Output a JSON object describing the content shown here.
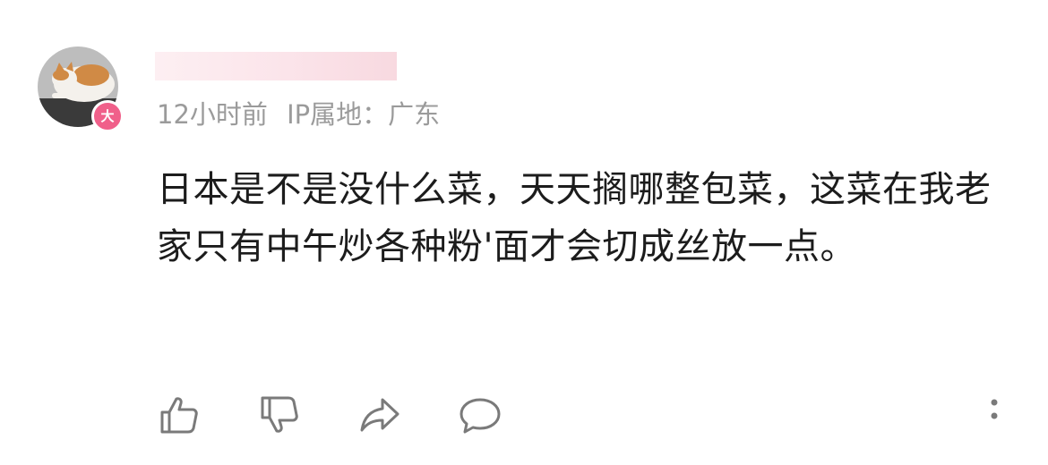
{
  "comment": {
    "level_badge": "大",
    "time": "12小时前",
    "ip_location": "IP属地：广东",
    "text": "日本是不是没什么菜，天天搁哪整包菜，这菜在我老家只有中午炒各种粉'面才会切成丝放一点。"
  },
  "actions": {
    "icons": [
      "thumbs-up-icon",
      "thumbs-down-icon",
      "share-icon",
      "reply-icon",
      "more-icon"
    ]
  },
  "colors": {
    "badge": "#f0608a",
    "meta_text": "#9b9b9b",
    "body_text": "#1c1c1c",
    "icon_stroke": "#7a7a7a"
  }
}
